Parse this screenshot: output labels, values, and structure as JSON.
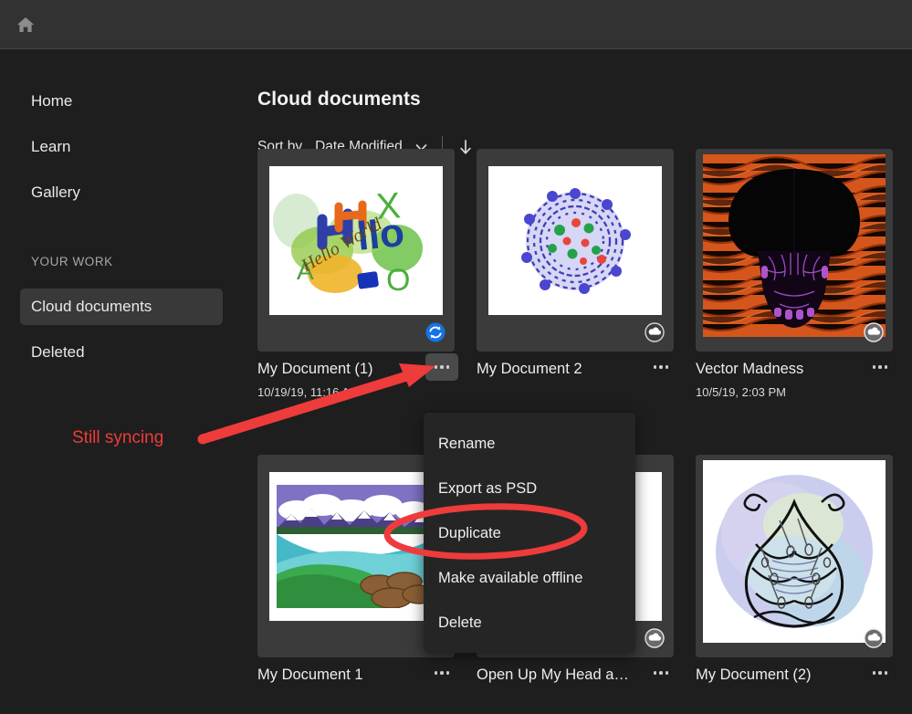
{
  "topbar": {
    "home_icon": "home-icon"
  },
  "sidebar": {
    "items": [
      {
        "label": "Home",
        "selected": false
      },
      {
        "label": "Learn",
        "selected": false
      },
      {
        "label": "Gallery",
        "selected": false
      }
    ],
    "section_label": "YOUR WORK",
    "work_items": [
      {
        "label": "Cloud documents",
        "selected": true
      },
      {
        "label": "Deleted",
        "selected": false
      }
    ]
  },
  "main": {
    "title": "Cloud documents",
    "sort": {
      "label": "Sort by",
      "value": "Date Modified",
      "chevron_icon": "chevron-down-icon",
      "direction_icon": "arrow-down-icon"
    }
  },
  "documents": [
    {
      "title": "My Document (1)",
      "date": "10/19/19, 11:16 AM",
      "status": "syncing",
      "status_icon": "sync-icon"
    },
    {
      "title": "My Document 2",
      "date": "",
      "status": "cloud",
      "status_icon": "cloud-icon"
    },
    {
      "title": "Vector Madness",
      "date": "10/5/19, 2:03 PM",
      "status": "cloud",
      "status_icon": "cloud-icon"
    },
    {
      "title": "My Document 1",
      "date": "",
      "status": "cloud",
      "status_icon": "cloud-icon"
    },
    {
      "title": "Open Up My Head a…",
      "date": "",
      "status": "cloud",
      "status_icon": "cloud-icon"
    },
    {
      "title": "My Document (2)",
      "date": "",
      "status": "cloud",
      "status_icon": "cloud-icon"
    }
  ],
  "context_menu": {
    "items": [
      {
        "label": "Rename"
      },
      {
        "label": "Export as PSD"
      },
      {
        "label": "Duplicate",
        "highlighted": true
      },
      {
        "label": "Make available offline"
      },
      {
        "label": "Delete"
      }
    ]
  },
  "annotations": {
    "syncing_note": "Still syncing",
    "arrow_icon": "red-arrow-annotation",
    "ellipse_icon": "red-ellipse-annotation"
  },
  "colors": {
    "background": "#1e1e1e",
    "topbar": "#323232",
    "card": "#3b3b3b",
    "selected_nav": "#393939",
    "menu": "#252525",
    "annotation_red": "#f03b3b",
    "sync_blue": "#1473e6"
  }
}
